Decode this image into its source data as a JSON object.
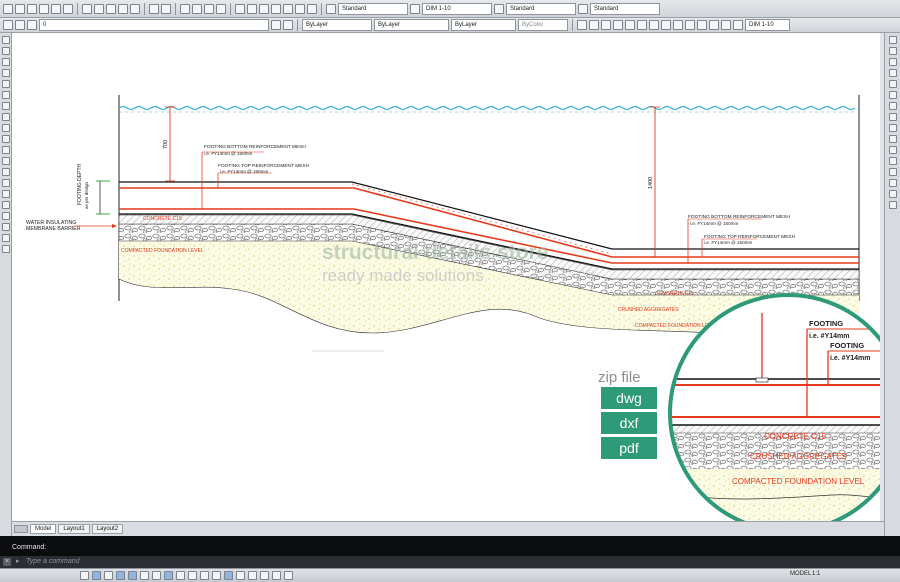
{
  "toolbar": {
    "layer_current": "0",
    "color": "ByLayer",
    "linetype": "ByLayer",
    "lineweight": "ByLayer",
    "plotstyle": "ByColor",
    "text_style": "Standard",
    "dim_style": "DIM 1-10",
    "table_style": "Standard",
    "multileader_style": "Standard",
    "dim_style_right": "DIM 1-10"
  },
  "drawing": {
    "labels": {
      "water_insulating": "WATER INSULATING",
      "membrane_barrier": "MEMBRANE BARRIER",
      "footing_depth": "FOOTING DEPTH",
      "footing_depth_sub": "as per design",
      "dim_700": "700",
      "dim_1400": "1400",
      "left_bottom_mesh": "FOOTING BOTTOM REINFORCEMENT MESH",
      "left_bottom_mesh_spec": "i.e. #Y14mm @ 150mm",
      "left_top_mesh": "FOOTING TOP REINFORCEMENT MESH",
      "left_top_mesh_spec": "i.e. #Y14mm @ 150mm",
      "left_concrete": "CONCRETE C15",
      "left_compacted": "COMPACTED FOUNDATION LEVEL",
      "right_bottom_mesh": "FOOTING BOTTOM REINFORCEMENT MESH",
      "right_bottom_mesh_spec": "i.e. #Y14mm @ 150mm",
      "right_top_mesh": "FOOTING TOP REINFORCEMENT MESH",
      "right_top_mesh_spec": "i.e. #Y14mm @ 150mm",
      "right_concrete": "CONCRETE C15",
      "right_crushed": "CRUSHED AGGREGATES",
      "right_compacted": "COMPACTED FOUNDATION LEVEL"
    },
    "watermark_line1": "structural details store",
    "watermark_line2": "ready made solutions",
    "watermark_fragment": "www.xx.xxx",
    "zoom": {
      "footing_1": "FOOTING",
      "spec_1": "i.e. #Y14mm",
      "footing_2": "FOOTING",
      "spec_2": "i.e. #Y14mm",
      "concrete": "CONCRETE C15",
      "crushed": "CRUSHED AGGREGATES",
      "compacted": "COMPACTED FOUNDATION LEVEL"
    }
  },
  "badge": {
    "zip_file": "zip file",
    "formats": [
      "dwg",
      "dxf",
      "pdf"
    ]
  },
  "tabs": [
    "Model",
    "Layout1",
    "Layout2"
  ],
  "command": {
    "history": "Command:",
    "prompt": "▸",
    "placeholder": "Type a command",
    "close": "×"
  },
  "status": {
    "model": "MODEL",
    "scale": "1:1"
  },
  "colors": {
    "rebar": "#e53a1c",
    "water": "#33b3d6",
    "badge": "#2e9a78"
  }
}
